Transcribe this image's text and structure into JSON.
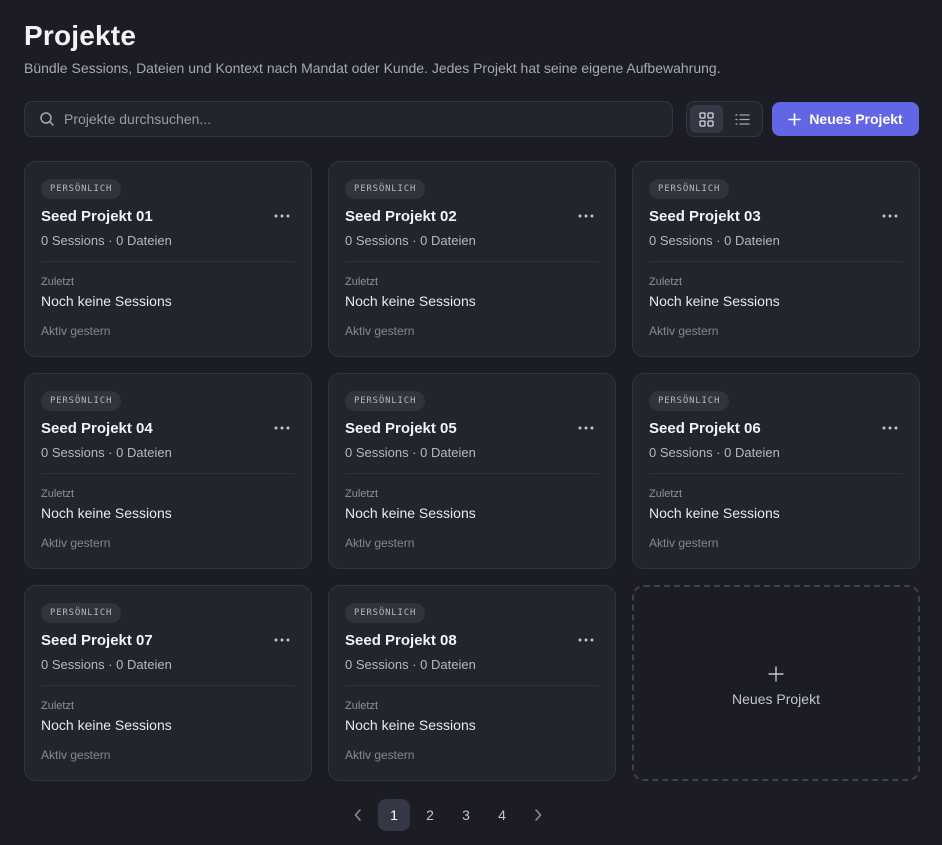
{
  "header": {
    "title": "Projekte",
    "subtitle": "Bündle Sessions, Dateien und Kontext nach Mandat oder Kunde. Jedes Projekt hat seine eigene Aufbewahrung."
  },
  "search": {
    "placeholder": "Projekte durchsuchen...",
    "value": ""
  },
  "view_toggle": {
    "active": "grid",
    "icons": [
      "grid-view-icon",
      "list-view-icon"
    ]
  },
  "new_project_button": {
    "label": "Neues Projekt",
    "icon": "plus-icon"
  },
  "projects": [
    {
      "badge": "PERSÖNLICH",
      "name": "Seed Projekt 01",
      "stats": "0 Sessions · 0 Dateien",
      "recent_label": "Zuletzt",
      "recent_value": "Noch keine Sessions",
      "activity": "Aktiv gestern"
    },
    {
      "badge": "PERSÖNLICH",
      "name": "Seed Projekt 02",
      "stats": "0 Sessions · 0 Dateien",
      "recent_label": "Zuletzt",
      "recent_value": "Noch keine Sessions",
      "activity": "Aktiv gestern"
    },
    {
      "badge": "PERSÖNLICH",
      "name": "Seed Projekt 03",
      "stats": "0 Sessions · 0 Dateien",
      "recent_label": "Zuletzt",
      "recent_value": "Noch keine Sessions",
      "activity": "Aktiv gestern"
    },
    {
      "badge": "PERSÖNLICH",
      "name": "Seed Projekt 04",
      "stats": "0 Sessions · 0 Dateien",
      "recent_label": "Zuletzt",
      "recent_value": "Noch keine Sessions",
      "activity": "Aktiv gestern"
    },
    {
      "badge": "PERSÖNLICH",
      "name": "Seed Projekt 05",
      "stats": "0 Sessions · 0 Dateien",
      "recent_label": "Zuletzt",
      "recent_value": "Noch keine Sessions",
      "activity": "Aktiv gestern"
    },
    {
      "badge": "PERSÖNLICH",
      "name": "Seed Projekt 06",
      "stats": "0 Sessions · 0 Dateien",
      "recent_label": "Zuletzt",
      "recent_value": "Noch keine Sessions",
      "activity": "Aktiv gestern"
    },
    {
      "badge": "PERSÖNLICH",
      "name": "Seed Projekt 07",
      "stats": "0 Sessions · 0 Dateien",
      "recent_label": "Zuletzt",
      "recent_value": "Noch keine Sessions",
      "activity": "Aktiv gestern"
    },
    {
      "badge": "PERSÖNLICH",
      "name": "Seed Projekt 08",
      "stats": "0 Sessions · 0 Dateien",
      "recent_label": "Zuletzt",
      "recent_value": "Noch keine Sessions",
      "activity": "Aktiv gestern"
    }
  ],
  "add_card": {
    "label": "Neues Projekt",
    "icon": "plus-icon"
  },
  "pagination": {
    "pages": [
      "1",
      "2",
      "3",
      "4"
    ],
    "current": "1",
    "icons": [
      "chevron-left-icon",
      "chevron-right-icon"
    ]
  },
  "colors": {
    "background": "#1c1d24",
    "card": "#23252d",
    "accent": "#6366e4",
    "border": "#33353f"
  }
}
